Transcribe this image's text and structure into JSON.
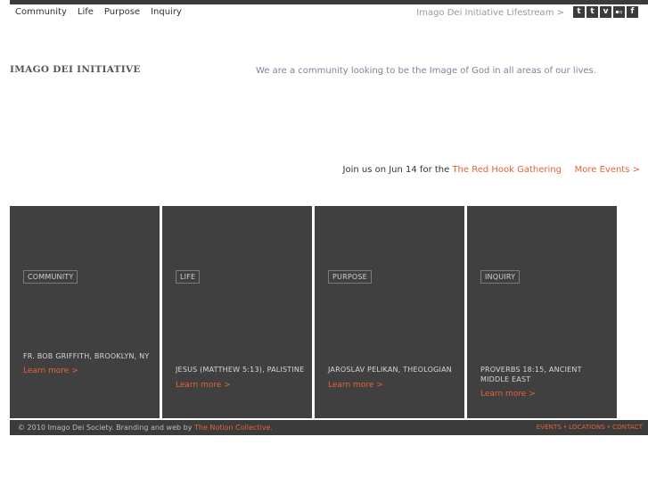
{
  "nav": {
    "items": [
      {
        "label": "Community"
      },
      {
        "label": "Life"
      },
      {
        "label": "Purpose"
      },
      {
        "label": "Inquiry"
      }
    ]
  },
  "header": {
    "lifestream_link": "Imago Dei Initiative Lifestream >",
    "social": [
      {
        "glyph": "t",
        "icon": "tumblr-icon"
      },
      {
        "glyph": "t",
        "icon": "twitter-icon"
      },
      {
        "glyph": "v",
        "icon": "vimeo-icon"
      },
      {
        "glyph": "▪▫",
        "icon": "flickr-icon"
      },
      {
        "glyph": "f",
        "icon": "facebook-icon"
      }
    ]
  },
  "brand": {
    "logo_text": "IMAGO DEI INITIATIVE",
    "tagline": "We are a community looking to be the Image of God in all areas of our lives."
  },
  "events": {
    "prefix": "Join us on Jun 14 for the ",
    "event_link": "The Red Hook Gathering",
    "more_link": "More Events >"
  },
  "panels": [
    {
      "tag": "COMMUNITY",
      "caption": "FR. BOB GRIFFITH, BROOKLYN, NY",
      "learn": "Learn more >"
    },
    {
      "tag": "LIFE",
      "caption": "JESUS (MATTHEW 5:13), PALISTINE",
      "learn": "Learn more >"
    },
    {
      "tag": "PURPOSE",
      "caption": "JAROSLAV PELIKAN, THEOLOGIAN",
      "learn": "Learn more >"
    },
    {
      "tag": "INQUIRY",
      "caption": "PROVERBS 18:15, ANCIENT MIDDLE EAST",
      "learn": "Learn more >"
    }
  ],
  "footer": {
    "copyright_prefix": "© 2010 Imago Dei Society. Branding and web by ",
    "credit_link": "The Notion Collective.",
    "links": [
      {
        "label": "EVENTS"
      },
      {
        "label": "LOCATIONS"
      },
      {
        "label": "CONTACT"
      }
    ],
    "separator": "•"
  },
  "colors": {
    "accent": "#e5623a",
    "panel_bg": "#404040",
    "bar_bg": "#3b3b3b"
  }
}
